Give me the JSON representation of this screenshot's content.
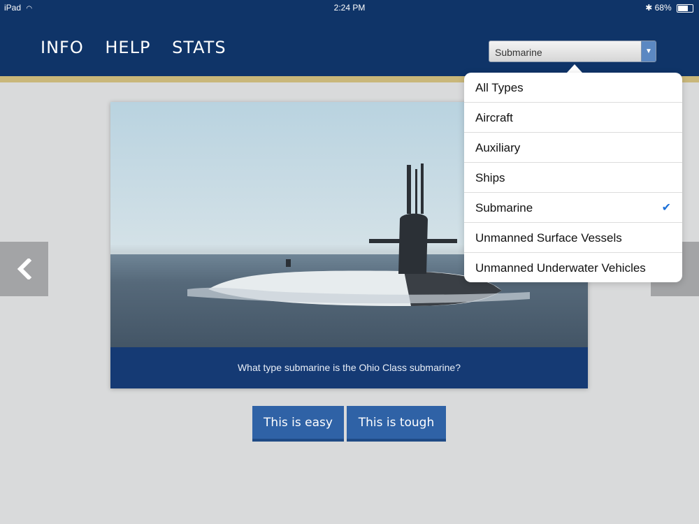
{
  "status": {
    "device": "iPad",
    "time": "2:24 PM",
    "battery": "68%",
    "battery_level": 0.68
  },
  "nav": [
    "INFO",
    "HELP",
    "STATS"
  ],
  "select": {
    "value": "Submarine",
    "options": [
      {
        "label": "All Types"
      },
      {
        "label": "Aircraft"
      },
      {
        "label": "Auxiliary"
      },
      {
        "label": "Ships"
      },
      {
        "label": "Submarine",
        "checked": true
      },
      {
        "label": "Unmanned Surface Vessels"
      },
      {
        "label": "Unmanned Underwater Vehicles"
      }
    ]
  },
  "card": {
    "caption": "What type submarine is the Ohio Class submarine?"
  },
  "buttons": {
    "easy": "This is easy",
    "tough": "This is tough"
  },
  "colors": {
    "header": "#0f3468",
    "accent": "#c9b77a",
    "button": "#2f62a6",
    "check": "#1a6fd8"
  }
}
